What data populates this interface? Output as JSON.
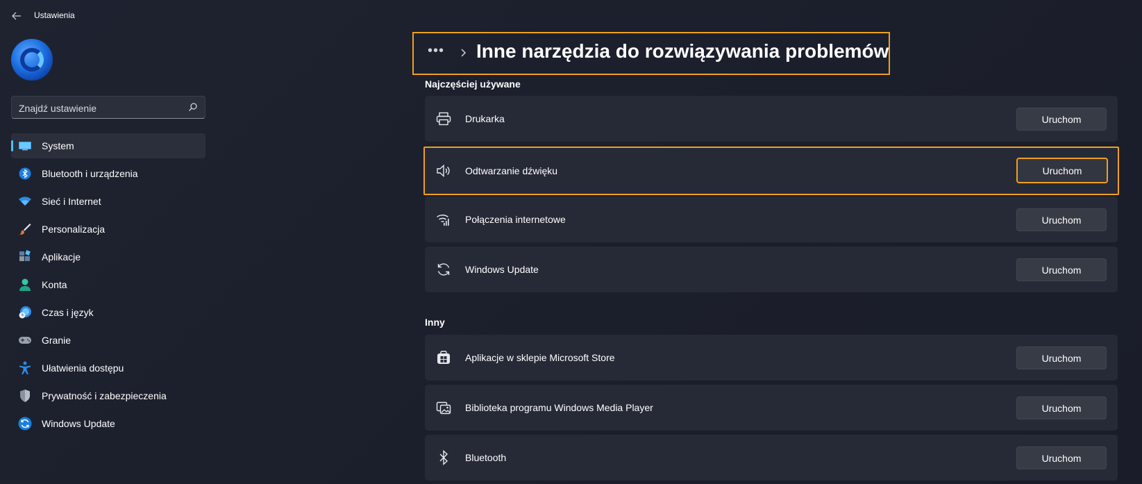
{
  "app": {
    "title": "Ustawienia"
  },
  "search": {
    "placeholder": "Znajdź ustawienie"
  },
  "sidebar": {
    "items": [
      {
        "label": "System",
        "icon": "system-icon",
        "active": true
      },
      {
        "label": "Bluetooth i urządzenia",
        "icon": "bluetooth-icon"
      },
      {
        "label": "Sieć i Internet",
        "icon": "wifi-icon"
      },
      {
        "label": "Personalizacja",
        "icon": "brush-icon"
      },
      {
        "label": "Aplikacje",
        "icon": "apps-icon"
      },
      {
        "label": "Konta",
        "icon": "account-icon"
      },
      {
        "label": "Czas i język",
        "icon": "time-language-icon"
      },
      {
        "label": "Granie",
        "icon": "gaming-icon"
      },
      {
        "label": "Ułatwienia dostępu",
        "icon": "accessibility-icon"
      },
      {
        "label": "Prywatność i zabezpieczenia",
        "icon": "shield-icon"
      },
      {
        "label": "Windows Update",
        "icon": "windows-update-icon"
      }
    ]
  },
  "header": {
    "breadcrumb_more": "•••",
    "title": "Inne narzędzia do rozwiązywania problemów"
  },
  "sections": {
    "frequent": {
      "title": "Najczęściej używane",
      "items": [
        {
          "label": "Drukarka",
          "icon": "printer-icon",
          "button": "Uruchom"
        },
        {
          "label": "Odtwarzanie dźwięku",
          "icon": "speaker-icon",
          "button": "Uruchom"
        },
        {
          "label": "Połączenia internetowe",
          "icon": "wifi-icon",
          "button": "Uruchom"
        },
        {
          "label": "Windows Update",
          "icon": "refresh-icon",
          "button": "Uruchom"
        }
      ]
    },
    "other": {
      "title": "Inny",
      "items": [
        {
          "label": "Aplikacje w sklepie Microsoft Store",
          "icon": "store-icon",
          "button": "Uruchom"
        },
        {
          "label": "Biblioteka programu Windows Media Player",
          "icon": "media-library-icon",
          "button": "Uruchom"
        },
        {
          "label": "Bluetooth",
          "icon": "bluetooth-icon",
          "button": "Uruchom"
        }
      ]
    }
  },
  "colors": {
    "accent": "#4cc2ff",
    "highlight": "#f0a01e",
    "background": "#1f2330",
    "card": "#262a36"
  }
}
